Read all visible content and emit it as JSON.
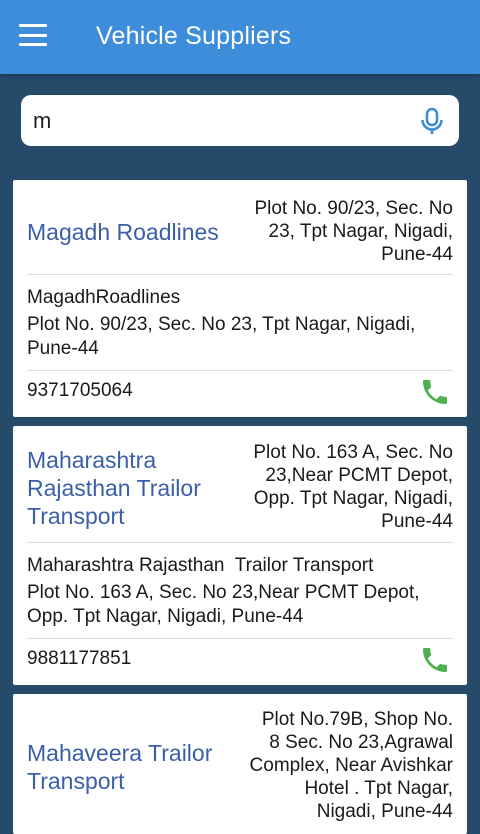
{
  "appbar": {
    "title": "Vehicle Suppliers",
    "menu_icon": "hamburger-menu-icon"
  },
  "search": {
    "value": "m",
    "mic_icon": "microphone-icon"
  },
  "colors": {
    "appbar": "#3d8ddb",
    "background": "#264a6a",
    "name_text": "#3a5fa8",
    "call_icon": "#4caf50"
  },
  "suppliers": [
    {
      "name_lines": [
        "Magadh Roadlines"
      ],
      "address_lines": [
        "Plot No. 90/23, Sec. No",
        "23, Tpt Nagar, Nigadi,",
        "Pune-44"
      ],
      "contact_name": "MagadhRoadlines",
      "detail_lines": [
        "Plot No. 90/23, Sec. No 23, Tpt Nagar, Nigadi,",
        "Pune-44"
      ],
      "phone": "9371705064"
    },
    {
      "name_lines": [
        "Maharashtra",
        "Rajasthan Trailor",
        "Transport"
      ],
      "address_lines": [
        "Plot No. 163 A, Sec. No",
        "23,Near PCMT Depot,",
        "Opp. Tpt Nagar, Nigadi,",
        "Pune-44"
      ],
      "contact_name": "Maharashtra Rajasthan  Trailor Transport",
      "detail_lines": [
        "Plot No. 163 A, Sec. No 23,Near PCMT Depot,",
        "Opp. Tpt Nagar, Nigadi, Pune-44"
      ],
      "phone": "9881177851"
    },
    {
      "name_lines": [
        "Mahaveera Trailor",
        "Transport"
      ],
      "address_lines": [
        "Plot No.79B, Shop No.",
        "8 Sec. No 23,Agrawal",
        "Complex, Near Avishkar",
        "Hotel . Tpt Nagar,",
        "Nigadi, Pune-44"
      ]
    }
  ]
}
